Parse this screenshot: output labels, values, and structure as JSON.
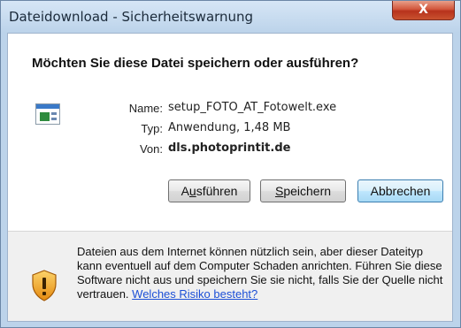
{
  "window": {
    "title": "Dateidownload - Sicherheitswarnung",
    "close_label": "X"
  },
  "dialog": {
    "question": "Möchten Sie diese Datei speichern oder ausführen?",
    "file_icon": "application-file-icon",
    "fields": {
      "name_label": "Name:",
      "name_value": "setup_FOTO_AT_Fotowelt.exe",
      "type_label": "Typ:",
      "type_value": "Anwendung, 1,48 MB",
      "from_label": "Von:",
      "from_value": "dls.photoprintit.de"
    },
    "buttons": {
      "run": {
        "pre": "A",
        "accel": "u",
        "post": "sführen"
      },
      "save": {
        "pre": "",
        "accel": "S",
        "post": "peichern"
      },
      "cancel": "Abbrechen"
    }
  },
  "footer": {
    "icon": "security-shield-warning-icon",
    "warning_text": "Dateien aus dem Internet können nützlich sein, aber dieser Dateityp kann eventuell auf dem Computer Schaden anrichten. Führen Sie diese Software nicht aus und speichern Sie sie nicht, falls Sie der Quelle nicht vertrauen.",
    "link_text": "Welches Risiko besteht?"
  },
  "colors": {
    "frame": "#bcd3ea",
    "close_button": "#c9522f",
    "link": "#1c4fd6",
    "shield_orange": "#f0a01e"
  }
}
